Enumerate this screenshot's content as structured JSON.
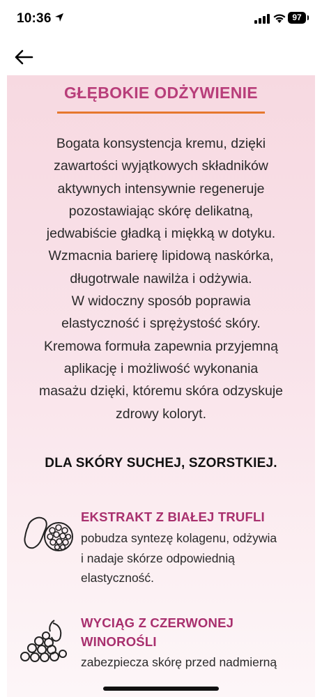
{
  "status_bar": {
    "time": "10:36",
    "battery": "97",
    "icons": [
      "location-arrow-icon",
      "cellular-signal-icon",
      "wifi-icon",
      "battery-icon"
    ]
  },
  "nav": {
    "back_icon": "arrow-left-icon"
  },
  "section": {
    "title": "GŁĘBOKIE ODŻYWIENIE",
    "description_lines": [
      "Bogata konsystencja kremu, dzięki",
      "zawartości wyjątkowych składników",
      "aktywnych intensywnie regeneruje",
      "pozostawiając skórę delikatną,",
      "jedwabiście gładką i miękką w dotyku.",
      "Wzmacnia barierę lipidową naskórka,",
      "długotrwale nawilża i odżywia.",
      "W widoczny sposób poprawia",
      "elastyczność i sprężystość skóry.",
      "Kremowa formuła zapewnia przyjemną",
      "aplikację i możliwość wykonania",
      "masażu dzięki, któremu skóra odzyskuje",
      "zdrowy koloryt."
    ],
    "skin_type": "DLA SKÓRY SUCHEJ, SZORSTKIEJ."
  },
  "ingredients": [
    {
      "icon": "truffle-icon",
      "title_lines": [
        "EKSTRAKT Z BIAŁEJ TRUFLI"
      ],
      "desc_lines": [
        "pobudza syntezę kolagenu, odżywia",
        "i nadaje skórze odpowiednią",
        "elastyczność."
      ]
    },
    {
      "icon": "grapes-icon",
      "title_lines": [
        "WYCIĄG Z CZERWONEJ",
        "WINOROŚLI"
      ],
      "desc_lines": [
        "zabezpiecza skórę przed nadmierną"
      ]
    }
  ],
  "colors": {
    "title": "#b83e7a",
    "underline": "#e6782e",
    "background": "#f7d9e1",
    "ingredient_title": "#a8306e"
  }
}
